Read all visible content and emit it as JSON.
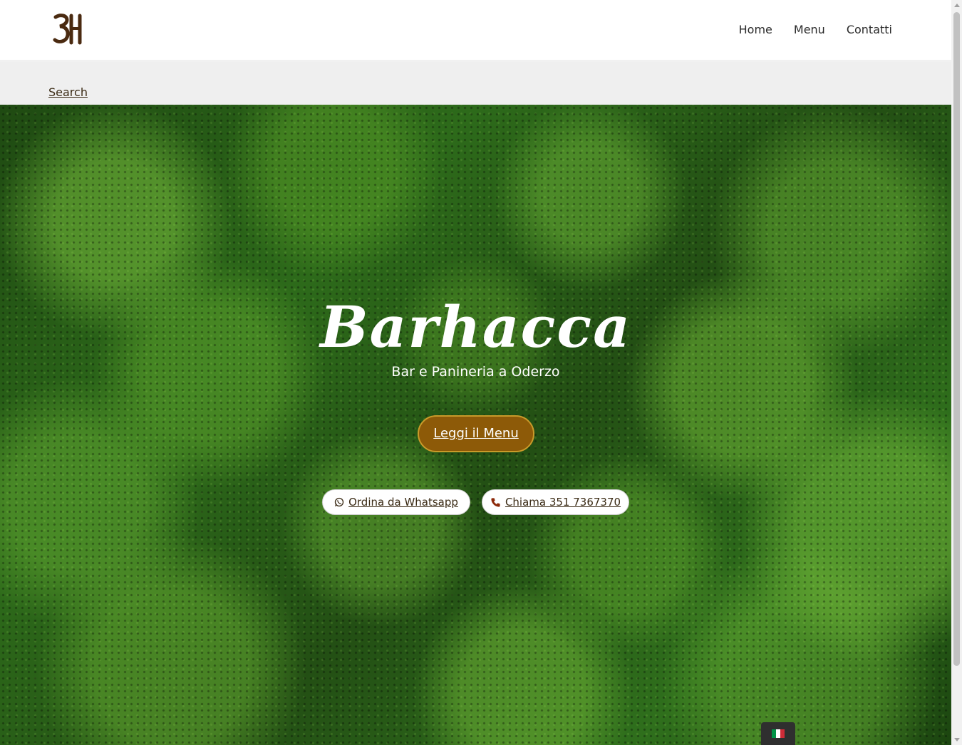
{
  "header": {
    "logo_text": "3H",
    "nav": [
      {
        "label": "Home"
      },
      {
        "label": "Menu"
      },
      {
        "label": "Contatti"
      }
    ]
  },
  "search": {
    "label": "Search"
  },
  "hero": {
    "title": "Barhacca",
    "subtitle": "Bar e Panineria a Oderzo",
    "menu_button": "Leggi il Menu",
    "whatsapp_button": "Ordina da Whatsapp",
    "call_button": "Chiama 351 7367370"
  },
  "language": {
    "icon": "italy-flag-icon"
  },
  "colors": {
    "brand_brown": "#8d5a08",
    "logo_brown": "#4a2a10",
    "text_dark": "#2a2a2a"
  }
}
